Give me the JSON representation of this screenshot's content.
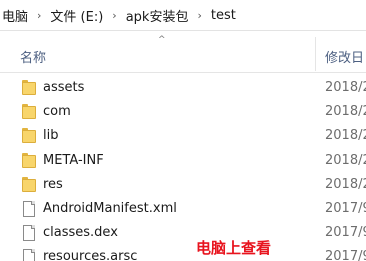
{
  "breadcrumb": {
    "items": [
      "电脑",
      "文件 (E:)",
      "apk安装包",
      "test"
    ],
    "separator": "›"
  },
  "header": {
    "name_label": "名称",
    "date_label": "修改日",
    "sort_arrow": "^"
  },
  "files": [
    {
      "name": "assets",
      "type": "folder",
      "date": "2018/2",
      "icon": "folder-icon"
    },
    {
      "name": "com",
      "type": "folder",
      "date": "2018/2",
      "icon": "folder-icon"
    },
    {
      "name": "lib",
      "type": "folder",
      "date": "2018/2",
      "icon": "folder-icon"
    },
    {
      "name": "META-INF",
      "type": "folder",
      "date": "2018/2",
      "icon": "folder-icon"
    },
    {
      "name": "res",
      "type": "folder",
      "date": "2018/2",
      "icon": "folder-icon"
    },
    {
      "name": "AndroidManifest.xml",
      "type": "file",
      "date": "2017/9",
      "icon": "file-icon"
    },
    {
      "name": "classes.dex",
      "type": "file",
      "date": "2017/9",
      "icon": "file-icon"
    },
    {
      "name": "resources.arsc",
      "type": "file",
      "date": "2017/9",
      "icon": "file-icon"
    }
  ],
  "overlay": {
    "caption": "电脑上查看",
    "color": "#e8141e"
  },
  "colors": {
    "folder": "#f8d56b",
    "header_text": "#4d6082"
  }
}
